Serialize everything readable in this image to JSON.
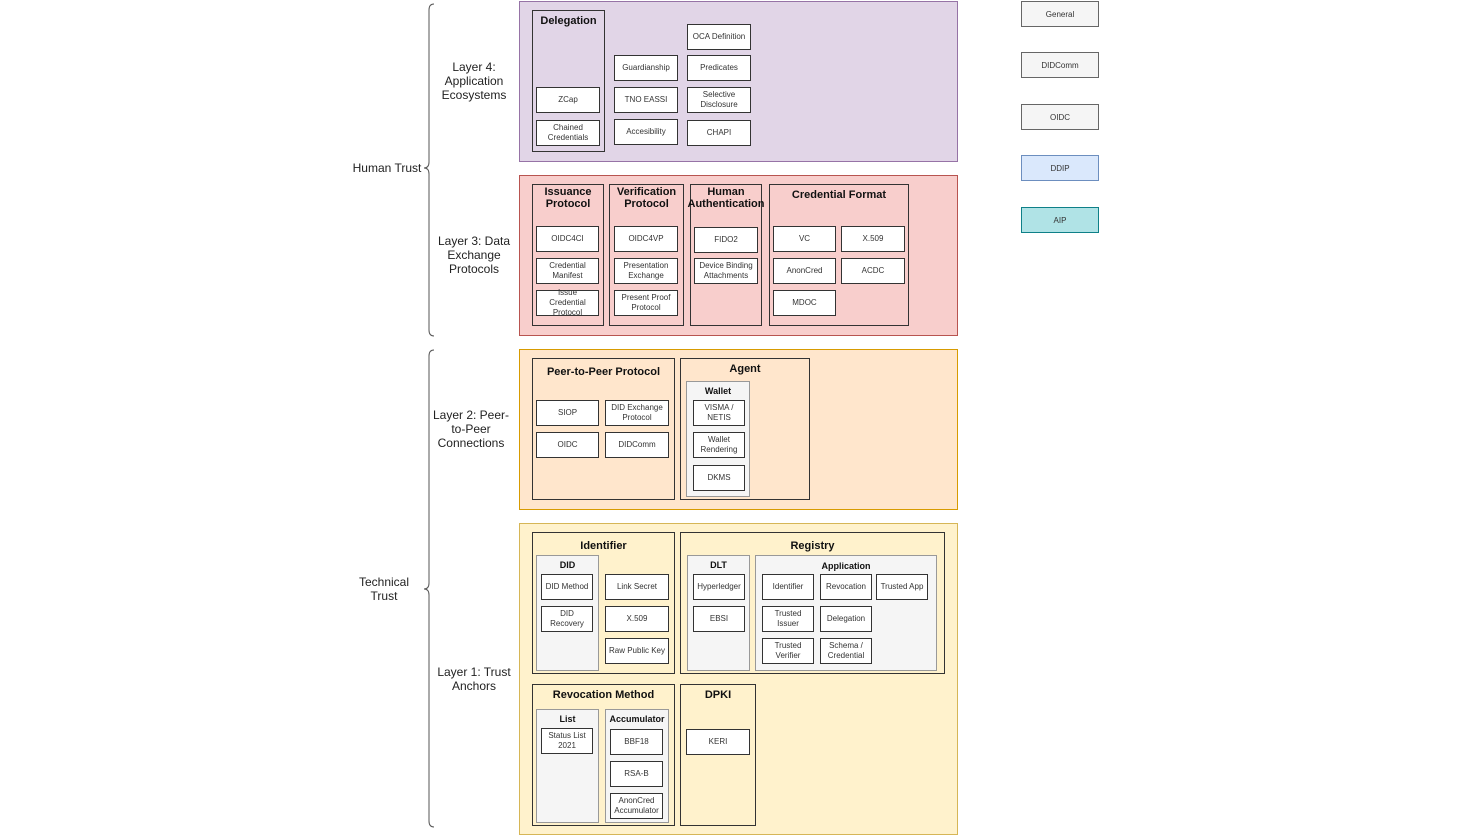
{
  "trust_groups": {
    "human": "Human Trust",
    "technical": "Technical Trust"
  },
  "layers": {
    "l4": {
      "label": "Layer 4: Application Ecosystems",
      "delegation": {
        "title": "Delegation",
        "items": [
          "ZCap",
          "Chained Credentials"
        ]
      },
      "col2": [
        "Guardianship",
        "TNO EASSI",
        "Accesibility"
      ],
      "col3": [
        "OCA Definition",
        "Predicates",
        "Selective Disclosure",
        "CHAPI"
      ]
    },
    "l3": {
      "label": "Layer 3: Data Exchange Protocols",
      "issuance": {
        "title": "Issuance Protocol",
        "items": [
          "OIDC4CI",
          "Credential Manifest",
          "Issue Credential Protocol"
        ]
      },
      "verification": {
        "title": "Verification Protocol",
        "items": [
          "OIDC4VP",
          "Presentation Exchange",
          "Present Proof Protocol"
        ]
      },
      "human_auth": {
        "title": "Human Authentication",
        "items": [
          "FIDO2",
          "Device Binding Attachments"
        ]
      },
      "credential_format": {
        "title": "Credential Format",
        "items": [
          "VC",
          "X.509",
          "AnonCred",
          "ACDC",
          "MDOC"
        ]
      }
    },
    "l2": {
      "label": "Layer 2: Peer-to-Peer Connections",
      "p2p": {
        "title": "Peer-to-Peer Protocol",
        "items": [
          "SIOP",
          "DID Exchange Protocol",
          "OIDC",
          "DIDComm"
        ]
      },
      "agent": {
        "title": "Agent",
        "wallet": {
          "title": "Wallet",
          "items": [
            "VISMA / NETIS",
            "Wallet Rendering",
            "DKMS"
          ]
        }
      }
    },
    "l1": {
      "label": "Layer 1: Trust Anchors",
      "identifier": {
        "title": "Identifier",
        "did": {
          "title": "DID",
          "items": [
            "DID Method",
            "DID Recovery"
          ]
        },
        "items": [
          "Link Secret",
          "X.509",
          "Raw Public Key"
        ]
      },
      "registry": {
        "title": "Registry",
        "dlt": {
          "title": "DLT",
          "items": [
            "Hyperledger",
            "EBSI"
          ]
        },
        "application": {
          "title": "Application",
          "items": [
            "Identifier",
            "Revocation",
            "Trusted App",
            "Trusted Issuer",
            "Delegation",
            "Trusted Verifier",
            "Schema / Credential"
          ]
        }
      },
      "revocation": {
        "title": "Revocation Method",
        "list": {
          "title": "List",
          "items": [
            "Status List 2021"
          ]
        },
        "accumulator": {
          "title": "Accumulator",
          "items": [
            "BBF18",
            "RSA-B",
            "AnonCred Accumulator"
          ]
        }
      },
      "dpki": {
        "title": "DPKI",
        "items": [
          "KERI"
        ]
      }
    }
  },
  "legend": [
    {
      "label": "General",
      "color": "#f5f5f5"
    },
    {
      "label": "DIDComm",
      "color": "#f5f5f5"
    },
    {
      "label": "OIDC",
      "color": "#f5f5f5"
    },
    {
      "label": "DDIP",
      "color": "#dae8fc"
    },
    {
      "label": "AIP",
      "color": "#b0e3e6"
    }
  ]
}
